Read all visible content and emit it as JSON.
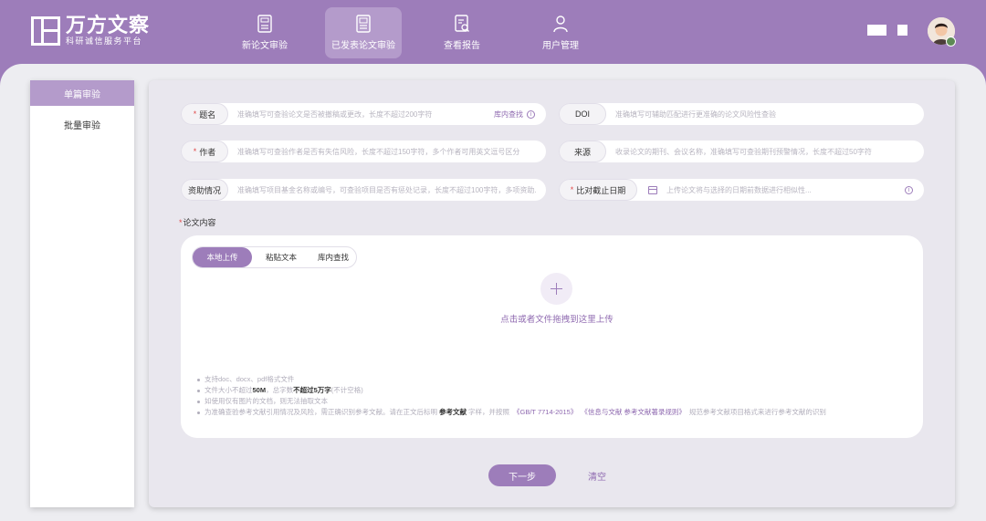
{
  "header": {
    "logo_title": "万方文察",
    "logo_sub": "科研诚信服务平台",
    "nav": [
      {
        "label": "新论文审验",
        "icon": "new-document-icon",
        "active": false
      },
      {
        "label": "已发表论文审验",
        "icon": "published-document-icon",
        "active": true
      },
      {
        "label": "查看报告",
        "icon": "report-search-icon",
        "active": false
      },
      {
        "label": "用户管理",
        "icon": "user-icon",
        "active": false
      }
    ]
  },
  "sidebar": {
    "items": [
      {
        "label": "单篇审验",
        "active": true
      },
      {
        "label": "批量审验",
        "active": false
      }
    ]
  },
  "form": {
    "title": {
      "label": "题名",
      "required": true,
      "placeholder": "准确填写可查验论文是否被撤稿或更改，长度不超过200字符",
      "search_link": "库内查找"
    },
    "doi": {
      "label": "DOI",
      "required": false,
      "placeholder": "准确填写可辅助匹配进行更准确的论文风险性查验"
    },
    "author": {
      "label": "作者",
      "required": true,
      "placeholder": "准确填写可查验作者是否有失信风险，长度不超过150字符，多个作者可用英文逗号区分"
    },
    "source": {
      "label": "来源",
      "required": false,
      "placeholder": "收录论文的期刊、会议名称，准确填写可查验期刊预警情况，长度不超过50字符"
    },
    "funding": {
      "label": "资助情况",
      "required": false,
      "placeholder": "准确填写项目基金名称或编号，可查验项目是否有惩处记录，长度不超过100字符，多项资助..."
    },
    "cutoff_date": {
      "label": "比对截止日期",
      "required": true,
      "placeholder": "上传论文将与选择的日期前数据进行相似性..."
    },
    "content_label": "论文内容",
    "content_required": true
  },
  "upload": {
    "tabs": [
      {
        "label": "本地上传",
        "active": true
      },
      {
        "label": "粘贴文本",
        "active": false
      },
      {
        "label": "库内查找",
        "active": false
      }
    ],
    "hint": "点击或者文件拖拽到这里上传",
    "notes": {
      "n1": "支持doc、docx、pdf格式文件",
      "n2_a": "文件大小不超过",
      "n2_b": "50M",
      "n2_c": "，总字数",
      "n2_d": "不超过5万字",
      "n2_e": "(不计空格)",
      "n3": "如使用仅有图片的文档，则无法抽取文本",
      "n4_a": "为准确查验参考文献引用情况及风险，需正确识别参考文献。请在正文后标明",
      "n4_b": "参考文献",
      "n4_c": "字样，并按照",
      "n4_d": "《GB/T 7714-2015》",
      "n4_e": "《信息与文献 参考文献著录规则》",
      "n4_f": "规范参考文献项目格式来进行参考文献的识别"
    }
  },
  "actions": {
    "next": "下一步",
    "clear": "清空"
  },
  "colors": {
    "brand": "#9d7dba",
    "nav_active": "#b49bcb",
    "required": "#e04b4b"
  }
}
